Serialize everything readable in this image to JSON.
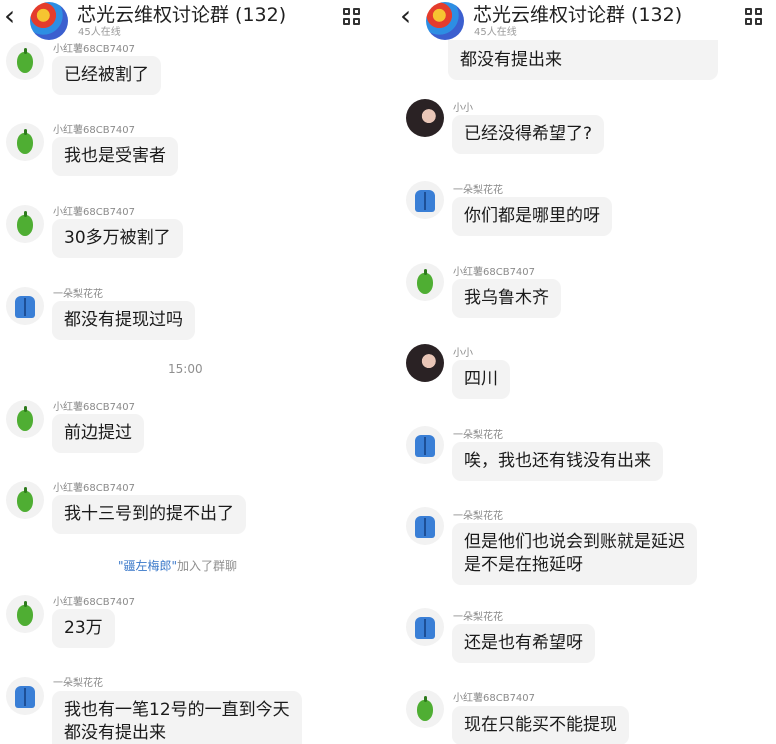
{
  "left": {
    "header": {
      "back_glyph": "‹",
      "title": "芯光云维权讨论群 (132)",
      "online": "45人在线"
    },
    "messages": [
      {
        "name": "小红薯68CB7407",
        "text": "已经被割了",
        "avatar": "pepper-icon"
      },
      {
        "name": "小红薯68CB7407",
        "text": "我也是受害者",
        "avatar": "pepper-icon"
      },
      {
        "name": "小红薯68CB7407",
        "text": "30多万被割了",
        "avatar": "pepper-icon"
      },
      {
        "name": "一朵梨花花",
        "text": "都没有提现过吗",
        "avatar": "coat-icon"
      },
      {
        "name": "小红薯68CB7407",
        "text": "前边提过",
        "avatar": "pepper-icon"
      },
      {
        "name": "小红薯68CB7407",
        "text": "我十三号到的提不出了",
        "avatar": "pepper-icon"
      },
      {
        "name": "小红薯68CB7407",
        "text": "23万",
        "avatar": "pepper-icon"
      },
      {
        "name": "一朵梨花花",
        "text": "我也有一笔12号的一直到今天\n都没有提出来",
        "avatar": "coat-icon"
      }
    ],
    "time": "15:00",
    "system": {
      "user": "\"疆左梅郎\"",
      "action": "加入了群聊"
    }
  },
  "right": {
    "header": {
      "back_glyph": "‹",
      "title": "芯光云维权讨论群 (132)",
      "online": "45人在线"
    },
    "top_clip": "都没有提出来",
    "messages": [
      {
        "name": "小小",
        "text": "已经没得希望了?",
        "avatar": "girl-avatar"
      },
      {
        "name": "一朵梨花花",
        "text": "你们都是哪里的呀",
        "avatar": "coat-icon"
      },
      {
        "name": "小红薯68CB7407",
        "text": "我乌鲁木齐",
        "avatar": "pepper-icon"
      },
      {
        "name": "小小",
        "text": "四川",
        "avatar": "girl-avatar"
      },
      {
        "name": "一朵梨花花",
        "text": "唉，我也还有钱没有出来",
        "avatar": "coat-icon"
      },
      {
        "name": "一朵梨花花",
        "text": "但是他们也说会到账就是延迟\n是不是在拖延呀",
        "avatar": "coat-icon"
      },
      {
        "name": "一朵梨花花",
        "text": "还是也有希望呀",
        "avatar": "coat-icon"
      },
      {
        "name": "小红薯68CB7407",
        "text": "现在只能买不能提现",
        "avatar": "pepper-icon"
      }
    ]
  }
}
